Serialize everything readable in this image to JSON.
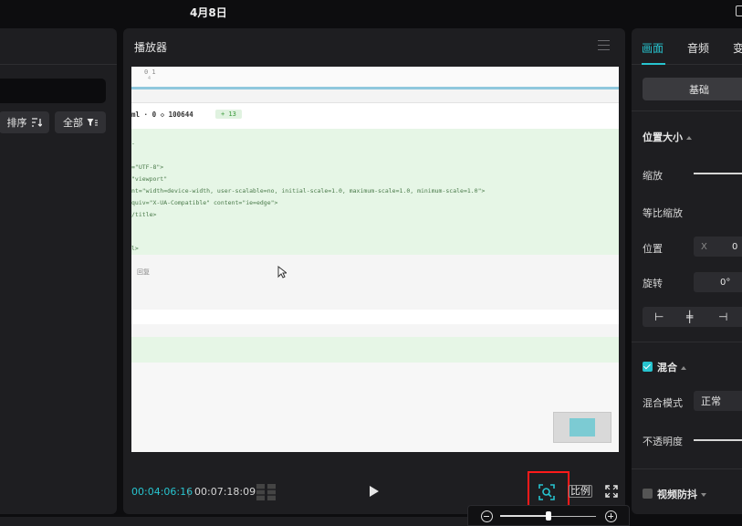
{
  "status_bar": {
    "date": "4月8日"
  },
  "media_panel": {
    "sort_label": "排序",
    "all_label": "全部"
  },
  "player": {
    "title": "播放器",
    "current_time": "00:04:06:16",
    "separator": "|",
    "total_time": "00:07:18:09",
    "ratio_label": "比例",
    "zoom_level": 0.5,
    "video_content": {
      "tab_text": "0 1",
      "tab_sub": "4",
      "file_info": "ml  ·  0  ◇  100644",
      "diff_badge": "+ 13",
      "code_lines": [
        "-",
        "=\"UTF-8\">",
        "\"viewport\"",
        "nt=\"width=device-width, user-scalable=no, initial-scale=1.0, maximum-scale=1.0, minimum-scale=1.0\">",
        "quiv=\"X-UA-Compatible\" content=\"ie=edge\">",
        "/title>",
        "",
        "",
        "l>"
      ],
      "row_label": "回复"
    }
  },
  "inspector": {
    "tabs": [
      "画面",
      "音频",
      "变"
    ],
    "basic_button": "基础",
    "position_size": {
      "header": "位置大小",
      "scale_label": "缩放",
      "uniform_scale_label": "等比缩放",
      "position_label": "位置",
      "x_label": "X",
      "x_value": "0",
      "rotation_label": "旋转",
      "rotation_value": "0°"
    },
    "blend": {
      "header": "混合",
      "mode_label": "混合模式",
      "mode_value": "正常",
      "opacity_label": "不透明度"
    },
    "stabilize": {
      "header": "视频防抖"
    }
  },
  "colors": {
    "accent": "#27c4cf",
    "highlight_box": "#ff1a1a",
    "panel_bg": "#1e1e21"
  }
}
